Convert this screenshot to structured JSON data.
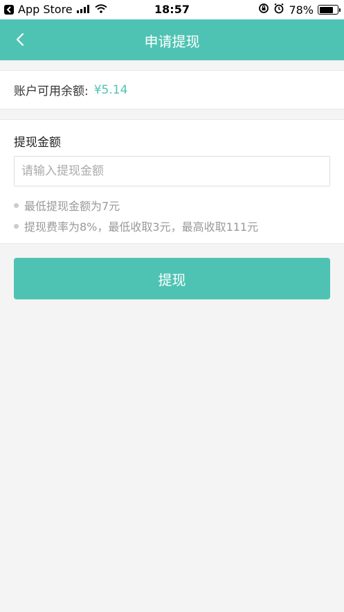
{
  "status_bar": {
    "carrier": "App Store",
    "time": "18:57",
    "battery": "78%",
    "battery_level": 0.78
  },
  "nav": {
    "title": "申请提现",
    "back_icon": "chevron-left-icon"
  },
  "balance": {
    "label": "账户可用余额:",
    "value": "¥5.14"
  },
  "form": {
    "title": "提现金额",
    "input_placeholder": "请输入提现金额",
    "input_value": "",
    "tips": [
      "最低提现金额为7元",
      "提现费率为8%，最低收取3元，最高收取111元"
    ]
  },
  "submit": {
    "label": "提现"
  },
  "colors": {
    "accent": "#4fc3b3",
    "background": "#f4f4f4"
  }
}
